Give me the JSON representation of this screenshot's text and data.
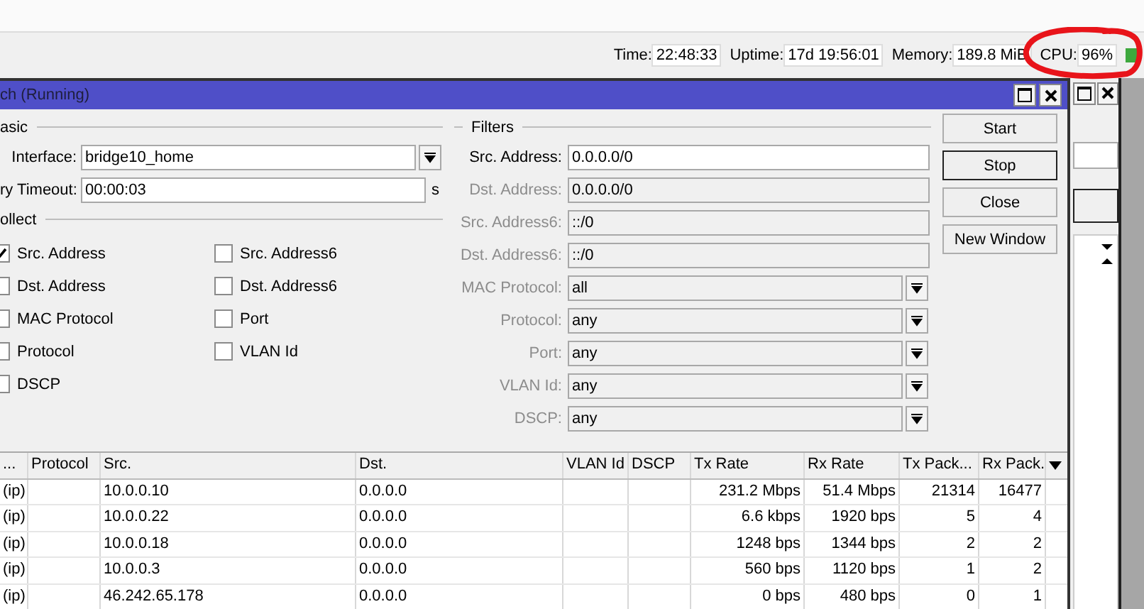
{
  "status_bar": {
    "items": [
      {
        "label": "Time:",
        "value": "22:48:33"
      },
      {
        "label": "Uptime:",
        "value": "17d 19:56:01"
      },
      {
        "label": "Memory:",
        "value": "189.8 MiB"
      },
      {
        "label": "CPU:",
        "value": "96%"
      }
    ]
  },
  "window": {
    "title": "ch (Running)"
  },
  "basic": {
    "title": "asic",
    "interface": {
      "label": "Interface:",
      "value": "bridge10_home"
    },
    "timeout": {
      "label": "ry Timeout:",
      "value": "00:00:03",
      "unit": "s"
    }
  },
  "collect": {
    "title": "ollect",
    "options": [
      {
        "label": "Src. Address",
        "checked": true
      },
      {
        "label": "Src. Address6",
        "checked": false
      },
      {
        "label": "Dst. Address",
        "checked": false
      },
      {
        "label": "Dst. Address6",
        "checked": false
      },
      {
        "label": "MAC Protocol",
        "checked": false
      },
      {
        "label": "Port",
        "checked": false
      },
      {
        "label": "Protocol",
        "checked": false
      },
      {
        "label": "VLAN Id",
        "checked": false
      },
      {
        "label": "DSCP",
        "checked": false
      }
    ]
  },
  "filters": {
    "title": "Filters",
    "rows": [
      {
        "label": "Src. Address:",
        "value": "0.0.0.0/0",
        "kind": "text",
        "disabled": false
      },
      {
        "label": "Dst. Address:",
        "value": "0.0.0.0/0",
        "kind": "text",
        "disabled": true
      },
      {
        "label": "Src. Address6:",
        "value": "::/0",
        "kind": "text",
        "disabled": true
      },
      {
        "label": "Dst. Address6:",
        "value": "::/0",
        "kind": "text",
        "disabled": true
      },
      {
        "label": "MAC Protocol:",
        "value": "all",
        "kind": "dropdown",
        "disabled": true
      },
      {
        "label": "Protocol:",
        "value": "any",
        "kind": "dropdown",
        "disabled": true
      },
      {
        "label": "Port:",
        "value": "any",
        "kind": "dropdown",
        "disabled": true
      },
      {
        "label": "VLAN Id:",
        "value": "any",
        "kind": "dropdown",
        "disabled": true
      },
      {
        "label": "DSCP:",
        "value": "any",
        "kind": "dropdown",
        "disabled": true
      }
    ]
  },
  "buttons": [
    {
      "label": "Start",
      "default": false
    },
    {
      "label": "Stop",
      "default": true
    },
    {
      "label": "Close",
      "default": false
    },
    {
      "label": "New Window",
      "default": false
    }
  ],
  "table": {
    "columns": [
      "...",
      "Protocol",
      "Src.",
      "Dst.",
      "VLAN Id",
      "DSCP",
      "Tx Rate",
      "Rx Rate",
      "Tx Pack...",
      "Rx Pack."
    ],
    "rows": [
      [
        "(ip)",
        null,
        "10.0.0.10",
        "0.0.0.0",
        null,
        null,
        "231.2 Mbps",
        "51.4 Mbps",
        "21314",
        "16477"
      ],
      [
        "(ip)",
        null,
        "10.0.0.22",
        "0.0.0.0",
        null,
        null,
        "6.6 kbps",
        "1920 bps",
        "5",
        "4"
      ],
      [
        "(ip)",
        null,
        "10.0.0.18",
        "0.0.0.0",
        null,
        null,
        "1248 bps",
        "1344 bps",
        "2",
        "2"
      ],
      [
        "(ip)",
        null,
        "10.0.0.3",
        "0.0.0.0",
        null,
        null,
        "560 bps",
        "1120 bps",
        "1",
        "2"
      ],
      [
        "(ip)",
        null,
        "46.242.65.178",
        "0.0.0.0",
        null,
        null,
        "0 bps",
        "480 bps",
        "0",
        "1"
      ]
    ]
  }
}
